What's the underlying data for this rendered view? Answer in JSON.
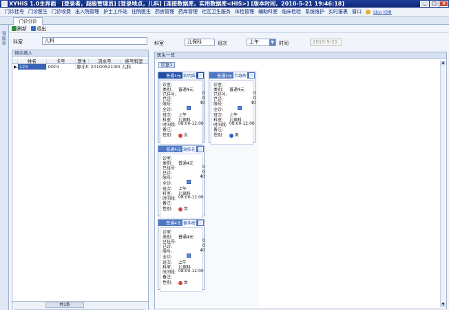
{
  "window": {
    "title": "XYHIS 1.0主界面　[登录者，超级管理员] [登录地点，儿科] [连接数据库，实用数据库<HIS>] [版本时间，2010-5-21 19:46:18]",
    "controls": [
      "_",
      "□",
      "×"
    ]
  },
  "menu": {
    "items": [
      "门诊挂号",
      "门诊医生",
      "门诊收费",
      "出入院管理",
      "护士工作站",
      "住院医生",
      "药房管理",
      "药库管理",
      "社区卫生服务",
      "体检管理",
      "辅助科室",
      "临床检验",
      "系统维护",
      "实时报表",
      "窗口"
    ],
    "skin_label": "Skin 切换"
  },
  "tab": {
    "label": "门诊分诊"
  },
  "side_label": "导航栏",
  "toolbar": {
    "refresh": "刷新",
    "exit": "退出"
  },
  "left": {
    "dept_label": "科室",
    "dept_value": "儿科",
    "grid_title": "待诊病人",
    "columns": [
      "",
      "姓名",
      "卡号",
      "医生",
      "流水号",
      "挂号科室"
    ],
    "rows": [
      {
        "marker": "▶",
        "name": "123",
        "card": "0001",
        "doctor": "廖小玲",
        "serial": "201005210008",
        "dept": "儿科"
      }
    ],
    "pager": "共1条"
  },
  "right": {
    "dept_label": "科室",
    "dept_value": "儿保科",
    "shift_label": "班次",
    "shift_value": "上午",
    "time_label": "时间",
    "time_value": "2010-5-21",
    "panel_title": "医生一览",
    "room_button": "诊室1"
  },
  "cards": [
    {
      "header": "普通4元",
      "doctor": "俞明娟",
      "room_label": "诊室:",
      "type_label": "类别:",
      "type": "普通4元",
      "registered_label": "已挂号:",
      "registered": "0",
      "seen_label": "已诊:",
      "seen": "0",
      "limit_label": "限号:",
      "limit": "40",
      "all_label": "全诊:",
      "shift_label": "班次:",
      "shift": "上午",
      "dept_label": "科室:",
      "dept": "儿保科",
      "time_label": "时间段:",
      "time": "08:00-12:00",
      "note_label": "备注:",
      "gender_label": "性别:",
      "gender": "女",
      "gender_icon": "female-icon"
    },
    {
      "header": "普通4元",
      "doctor": "韦惠辉",
      "room_label": "诊室:",
      "type_label": "类别:",
      "type": "普通4元",
      "registered_label": "已挂号:",
      "registered": "0",
      "seen_label": "已诊:",
      "seen": "0",
      "limit_label": "限号:",
      "limit": "40",
      "all_label": "全诊:",
      "shift_label": "班次:",
      "shift": "上午",
      "dept_label": "科室:",
      "dept": "儿保科",
      "time_label": "时间段:",
      "time": "08:00-12:00",
      "note_label": "备注:",
      "gender_label": "性别:",
      "gender": "男",
      "gender_icon": "male-icon"
    },
    {
      "header": "普通4元",
      "doctor": "谢肤花",
      "room_label": "诊室:",
      "type_label": "类别:",
      "type": "普通4元",
      "registered_label": "已挂号:",
      "registered": "0",
      "seen_label": "已诊:",
      "seen": "0",
      "limit_label": "限号:",
      "limit": "40",
      "all_label": "全诊:",
      "shift_label": "班次:",
      "shift": "上午",
      "dept_label": "科室:",
      "dept": "儿保科",
      "time_label": "时间段:",
      "time": "08:00-12:00",
      "note_label": "备注:",
      "gender_label": "性别:",
      "gender": "女",
      "gender_icon": "female-icon"
    },
    {
      "header": "普通4元",
      "doctor": "黄伟梅",
      "room_label": "诊室:",
      "type_label": "类别:",
      "type": "普通4元",
      "registered_label": "已挂号:",
      "registered": "0",
      "seen_label": "已诊:",
      "seen": "0",
      "limit_label": "限号:",
      "limit": "40",
      "all_label": "全诊:",
      "shift_label": "班次:",
      "shift": "上午",
      "dept_label": "科室:",
      "dept": "儿保科",
      "time_label": "时间段:",
      "time": "08:00-12:00",
      "note_label": "备注:",
      "gender_label": "性别:",
      "gender": "女",
      "gender_icon": "female-icon"
    }
  ]
}
